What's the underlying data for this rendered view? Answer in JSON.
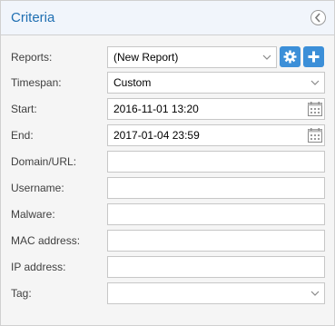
{
  "panel": {
    "title": "Criteria"
  },
  "form": {
    "reports": {
      "label": "Reports:",
      "value": "(New Report)"
    },
    "timespan": {
      "label": "Timespan:",
      "value": "Custom"
    },
    "start": {
      "label": "Start:",
      "value": "2016-11-01 13:20"
    },
    "end": {
      "label": "End:",
      "value": "2017-01-04 23:59"
    },
    "domain": {
      "label": "Domain/URL:",
      "value": ""
    },
    "username": {
      "label": "Username:",
      "value": ""
    },
    "malware": {
      "label": "Malware:",
      "value": ""
    },
    "mac": {
      "label": "MAC address:",
      "value": ""
    },
    "ip": {
      "label": "IP address:",
      "value": ""
    },
    "tag": {
      "label": "Tag:",
      "value": ""
    }
  },
  "icons": {
    "collapse": "chevron-left-circle-icon",
    "settings": "gear-icon",
    "add": "plus-icon",
    "dropdown": "chevron-down-icon",
    "calendar": "calendar-icon"
  },
  "colors": {
    "title": "#1f6fb2",
    "header_bg": "#f1f5fb",
    "button_bg": "#3c8fd8"
  }
}
